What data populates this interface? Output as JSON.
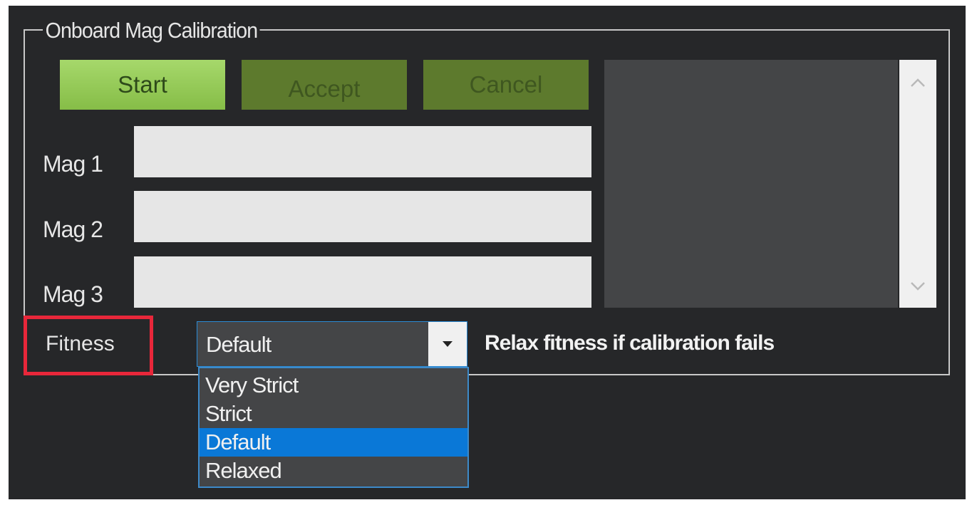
{
  "group": {
    "title": "Onboard Mag Calibration"
  },
  "buttons": {
    "start": "Start",
    "accept": "Accept",
    "cancel": "Cancel"
  },
  "mags": [
    {
      "label": "Mag 1",
      "value": ""
    },
    {
      "label": "Mag 2",
      "value": ""
    },
    {
      "label": "Mag 3",
      "value": ""
    }
  ],
  "log": {
    "scroll_up_icon": "chevron-up-icon",
    "scroll_down_icon": "chevron-down-icon"
  },
  "fitness": {
    "label": "Fitness",
    "selected": "Default",
    "options": [
      "Very Strict",
      "Strict",
      "Default",
      "Relaxed"
    ],
    "relax_label": "Relax fitness if calibration fails"
  },
  "colors": {
    "start_button": "#9acc5e",
    "disabled_button": "#5d7a2d",
    "highlight_box": "#e8273a",
    "selected_option": "#0a78d7"
  }
}
